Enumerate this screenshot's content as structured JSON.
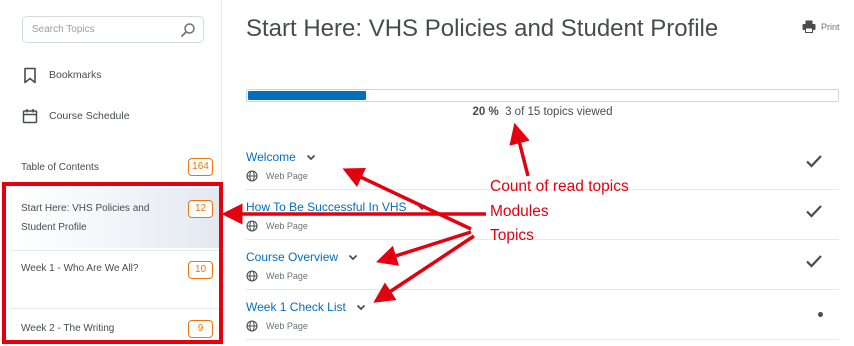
{
  "sidebar": {
    "search_placeholder": "Search Topics",
    "nav": [
      {
        "label": "Bookmarks",
        "icon": "bookmark-icon"
      },
      {
        "label": "Course Schedule",
        "icon": "calendar-icon"
      }
    ],
    "toc": {
      "header_label": "Table of Contents",
      "header_count": "164",
      "modules": [
        {
          "label": "Start Here: VHS Policies and Student Profile",
          "count": "12",
          "selected": true
        },
        {
          "label": "Week 1 - Who Are We All?",
          "count": "10"
        },
        {
          "label": "Week 2 - The Writing",
          "count": "9"
        }
      ]
    }
  },
  "main": {
    "title": "Start Here: VHS Policies and Student Profile",
    "print_label": "Print",
    "progress": {
      "percent_label": "20 %",
      "viewed_label": "3 of 15 topics viewed",
      "fraction": 0.2
    },
    "topics": [
      {
        "title": "Welcome",
        "type": "Web Page",
        "status": "completed"
      },
      {
        "title": "How To Be Successful In VHS",
        "type": "Web Page",
        "status": "completed"
      },
      {
        "title": "Course Overview",
        "type": "Web Page",
        "status": "completed"
      },
      {
        "title": "Week 1 Check List",
        "type": "Web Page",
        "status": "not-viewed"
      }
    ]
  },
  "annotations": {
    "labels": [
      "Count of read topics",
      "Modules",
      "Topics"
    ],
    "color": "#e3000f"
  },
  "colors": {
    "accent": "#006fbf",
    "badge": "#e87511",
    "text": "#494c4e"
  }
}
